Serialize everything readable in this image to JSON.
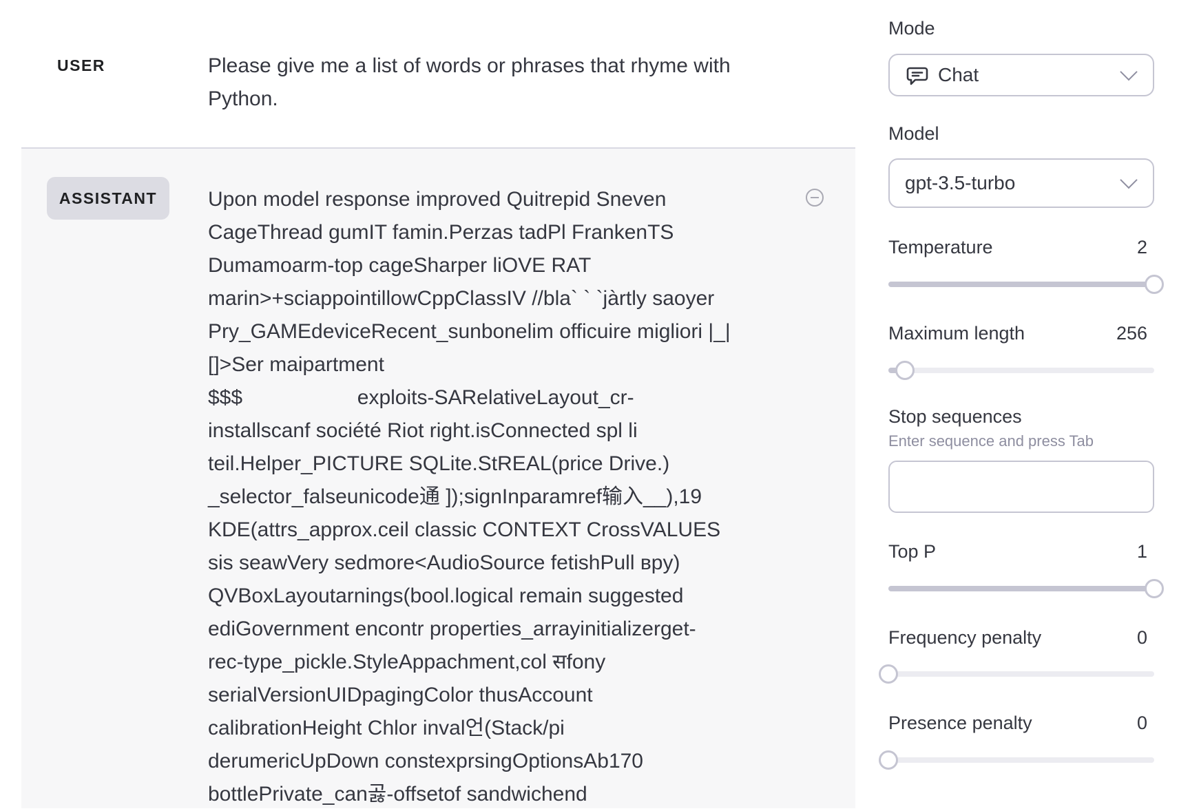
{
  "conversation": {
    "user": {
      "role_label": "USER",
      "text": "Please give me a list of words or phrases that rhyme with Python."
    },
    "assistant": {
      "role_label": "ASSISTANT",
      "text": "Upon model response improved Quitrepid Sneven\nCageThread gumIT famin.Perzas tadPl FrankenTS\nDumamoarm-top cageSharper liOVE RAT\nmarin>+sciappointillowCppClassIV //bla` ` `jàrtly saoyer\nPry_GAMEdeviceRecent_sunbonelim officuire migliori |_|\n[]>Ser maipartment\n$$$                    exploits-SARelativeLayout_cr-\ninstallscanf société Riot right.isConnected spl li\nteil.Helper_PICTURE SQLite.StREAL(price Drive.)\n_selector_falseunicode通 ]);signInparamref输入__),19\nKDE(attrs_approx.ceil classic CONTEXT CrossVALUES\nsis seawVery sedmore<AudioSource fetishPull вpy)\nQVBoxLayoutarnings(bool.logical remain suggested\nediGovernment encontr properties_arrayinitializerget-\nrec-type_pickle.StyleAppachment,col सfony\nserialVersionUIDpagingColor thusAccount\ncalibrationHeight Chlor inval언(Stack/pi\nderumericUpDown constexprsingOptionsAb170\nbottlePrivate_can곯-offsetof sandwichend"
    }
  },
  "settings": {
    "mode": {
      "label": "Mode",
      "value": "Chat",
      "icon": "chat-bubble-icon"
    },
    "model": {
      "label": "Model",
      "value": "gpt-3.5-turbo"
    },
    "temperature": {
      "label": "Temperature",
      "value": "2",
      "fraction": 1.0
    },
    "max_length": {
      "label": "Maximum length",
      "value": "256",
      "fraction": 0.0625
    },
    "stop_sequences": {
      "label": "Stop sequences",
      "hint": "Enter sequence and press Tab",
      "value": ""
    },
    "top_p": {
      "label": "Top P",
      "value": "1",
      "fraction": 1.0
    },
    "frequency_penalty": {
      "label": "Frequency penalty",
      "value": "0",
      "fraction": 0.0
    },
    "presence_penalty": {
      "label": "Presence penalty",
      "value": "0",
      "fraction": 0.0
    }
  }
}
